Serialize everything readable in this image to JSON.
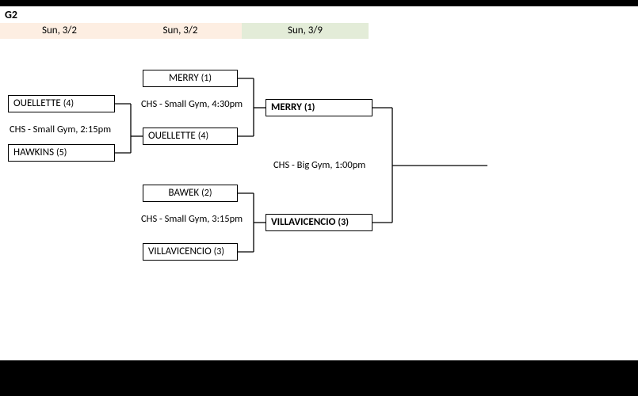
{
  "title": "G2",
  "columns": [
    {
      "date": "Sun, 3/2"
    },
    {
      "date": "Sun, 3/2"
    },
    {
      "date": "Sun, 3/9"
    }
  ],
  "round1": {
    "match1": {
      "top": {
        "name": "OUELLETTE",
        "seed": "(4)"
      },
      "bottom": {
        "name": "HAWKINS",
        "seed": "(5)"
      },
      "info": "CHS - Small Gym, 2:15pm"
    }
  },
  "round2": {
    "match1": {
      "top": {
        "name": "MERRY",
        "seed": "(1)"
      },
      "bottom": {
        "name": "OUELLETTE",
        "seed": "(4)"
      },
      "info": "CHS - Small Gym, 4:30pm"
    },
    "match2": {
      "top": {
        "name": "BAWEK",
        "seed": "(2)"
      },
      "bottom": {
        "name": "VILLAVICENCIO",
        "seed": "(3)"
      },
      "info": "CHS - Small Gym, 3:15pm"
    }
  },
  "final": {
    "top": {
      "name": "MERRY",
      "seed": "(1)"
    },
    "bottom": {
      "name": "VILLAVICENCIO",
      "seed": "(3)"
    },
    "info": "CHS - Big Gym, 1:00pm"
  }
}
